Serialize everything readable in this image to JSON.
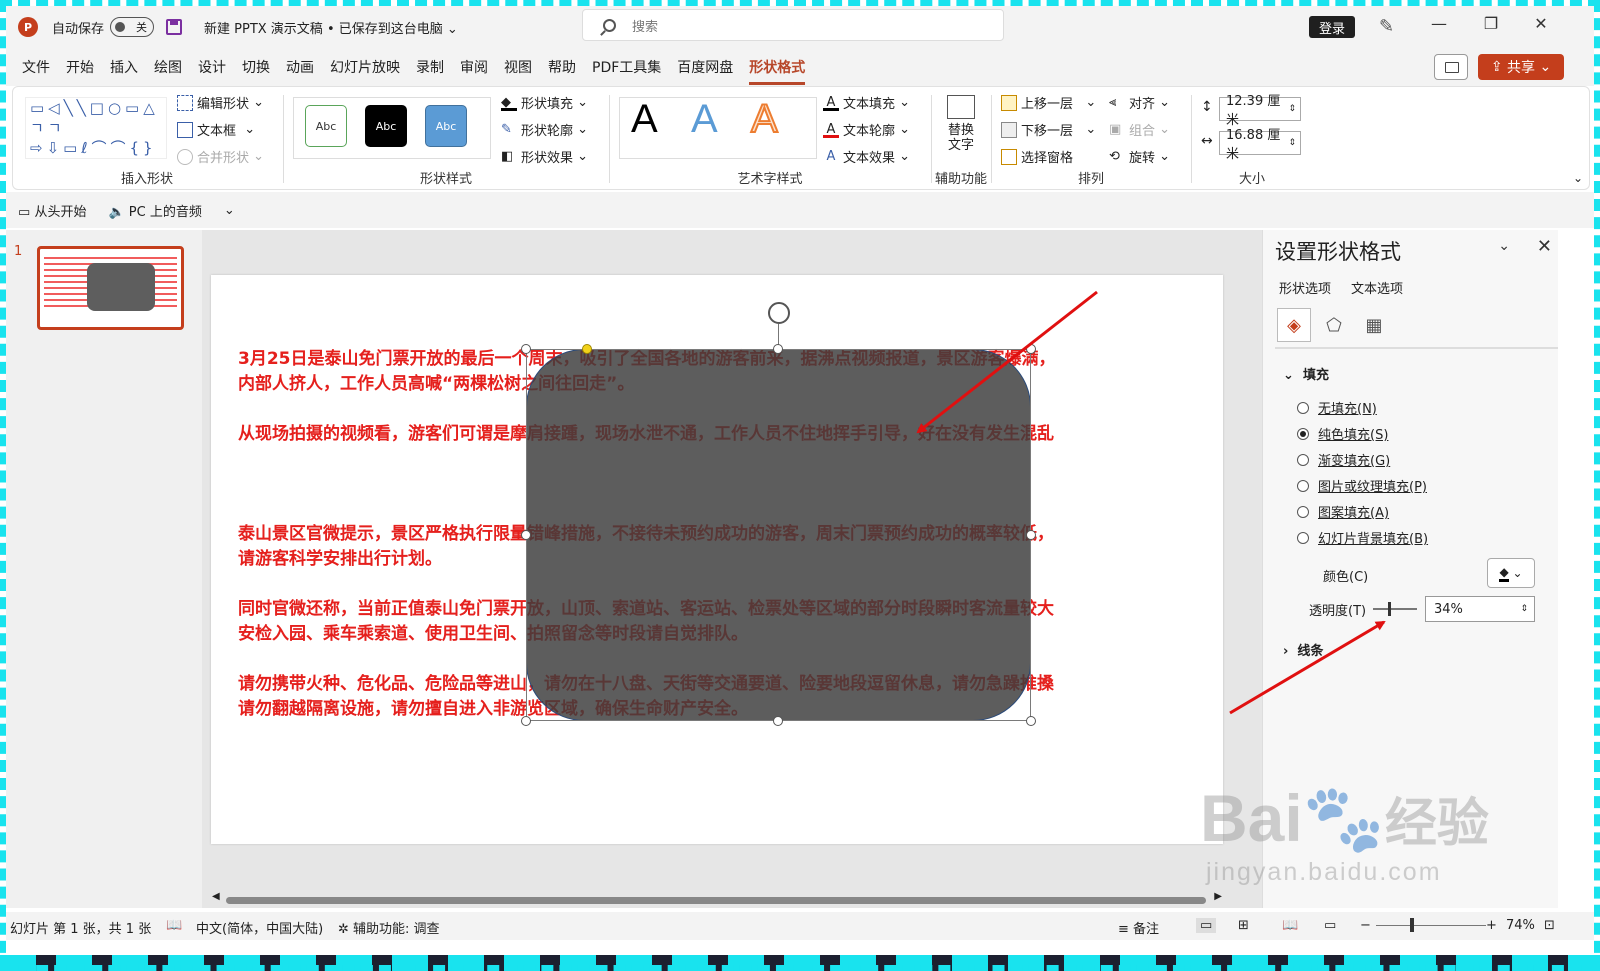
{
  "title_bar": {
    "app_logo": "P",
    "autosave_label": "自动保存",
    "autosave_state": "关",
    "doc_title": "新建 PPTX 演示文稿 • 已保存到这台电脑",
    "search_placeholder": "搜索",
    "login_label": "登录",
    "minimize": "—",
    "restore": "❐",
    "close": "✕"
  },
  "menu": {
    "tabs": [
      "文件",
      "开始",
      "插入",
      "绘图",
      "设计",
      "切换",
      "动画",
      "幻灯片放映",
      "录制",
      "审阅",
      "视图",
      "帮助",
      "PDF工具集",
      "百度网盘",
      "形状格式"
    ],
    "active_tab": "形状格式",
    "share_label": "共享"
  },
  "ribbon": {
    "insert_shapes": {
      "label": "插入形状",
      "edit_shape": "编辑形状",
      "text_box": "文本框",
      "merge_shapes": "合并形状",
      "shape_icons": "▭◁╲╲□○▭△ㄱㄱ⇨⇩▭ℓ⌒⌒{}"
    },
    "shape_styles": {
      "label": "形状样式",
      "presets": [
        "Abc",
        "Abc",
        "Abc"
      ],
      "fill": "形状填充",
      "outline": "形状轮廓",
      "effects": "形状效果"
    },
    "wordart": {
      "label": "艺术字样式",
      "letters": [
        "A",
        "A",
        "A"
      ],
      "text_fill": "文本填充",
      "text_outline": "文本轮廓",
      "text_effects": "文本效果"
    },
    "accessibility": {
      "label": "辅助功能",
      "alt_text": "替换文字"
    },
    "arrange": {
      "label": "排列",
      "bring_forward": "上移一层",
      "send_backward": "下移一层",
      "selection_pane": "选择窗格",
      "align": "对齐",
      "group": "组合",
      "rotate": "旋转"
    },
    "size": {
      "label": "大小",
      "height": "12.39 厘米",
      "width": "16.88 厘米"
    }
  },
  "quick_access": {
    "from_start": "从头开始",
    "audio": "PC 上的音频"
  },
  "thumbnails": {
    "slide_number": "1"
  },
  "slide": {
    "paragraphs": [
      [
        "3月25日是泰山免门票开放的最后一个周末，吸引了全国各地的游客前来，据沸点视频报道，景区游客爆满，",
        "内部人挤人，工作人员高喊“两棵松树之间往回走”。"
      ],
      [
        "从现场拍摄的视频看，游客们可谓是摩肩接踵，现场水泄不通，工作人员不住地挥手引导，好在没有发生混乱"
      ],
      [
        "泰山景区官微提示，景区严格执行限量错峰措施，不接待未预约成功的游客，周末门票预约成功的概率较低，",
        "请游客科学安排出行计划。"
      ],
      [
        "同时官微还称，当前正值泰山免门票开放，山顶、索道站、客运站、检票处等区域的部分时段瞬时客流量较大",
        "安检入园、乘车乘索道、使用卫生间、拍照留念等时段请自觉排队。"
      ],
      [
        "请勿携带火种、危化品、危险品等进山，请勿在十八盘、天街等交通要道、险要地段逗留休息，请勿急躁推搡",
        "请勿翻越隔离设施，请勿擅自进入非游览区域，确保生命财产安全。"
      ]
    ],
    "text_color": "#e5201d",
    "shape_color": "#3c3c3c",
    "shape_transparency": 0.34
  },
  "format_pane": {
    "title": "设置形状格式",
    "tab_shape": "形状选项",
    "tab_text": "文本选项",
    "section_fill": "填充",
    "fill_options": [
      "无填充(N)",
      "纯色填充(S)",
      "渐变填充(G)",
      "图片或纹理填充(P)",
      "图案填充(A)",
      "幻灯片背景填充(B)"
    ],
    "selected_fill": "纯色填充(S)",
    "color_label": "颜色(C)",
    "transparency_label": "透明度(T)",
    "transparency_value": "34%",
    "section_line": "线条"
  },
  "status_bar": {
    "slide_info": "幻灯片 第 1 张，共 1 张",
    "language": "中文(简体，中国大陆)",
    "accessibility": "辅助功能: 调查",
    "notes": "备注",
    "zoom": "74%"
  },
  "watermark": {
    "brand": "Bai",
    "brand_suffix": "经验",
    "url": "jingyan.baidu.com"
  },
  "colors": {
    "accent": "#b7472a",
    "annotation_arrow": "#e01010",
    "dashed_border": "#19e3ee"
  }
}
